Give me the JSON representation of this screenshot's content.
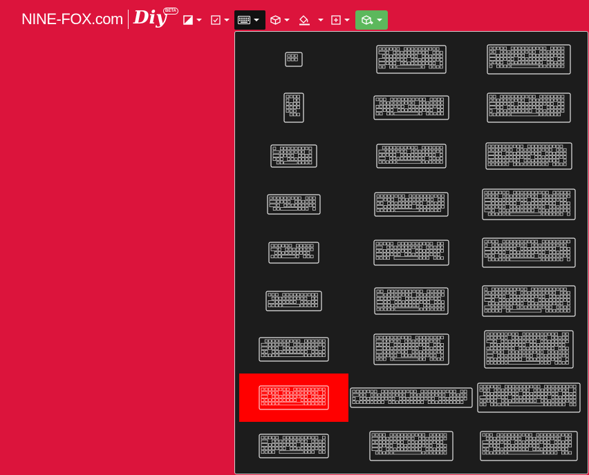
{
  "brand": {
    "logo_text": "NINE-FOX.com",
    "diy_text": "Diy",
    "beta_badge": "BETA"
  },
  "colors": {
    "background": "#dc143c",
    "menu_bg": "#1c1c1c",
    "active_tool": "#111111",
    "green_tool": "#5cb85c",
    "selected_item": "#ff0000"
  },
  "toolbar": [
    {
      "name": "color-tool",
      "icon": "paint-icon"
    },
    {
      "name": "select-tool",
      "icon": "checkbox-icon"
    },
    {
      "name": "layout-tool",
      "icon": "keyboard-icon",
      "active": true
    },
    {
      "name": "case-tool",
      "icon": "cube-icon"
    },
    {
      "name": "fill-tool",
      "icon": "paint-bucket-icon"
    },
    {
      "name": "add-tool",
      "icon": "plus-square-icon"
    },
    {
      "name": "export-tool",
      "icon": "box-share-icon",
      "highlight": true
    }
  ],
  "layout_menu": {
    "selected_index": 21,
    "items": [
      {
        "id": "keypad-4"
      },
      {
        "id": "60-percent"
      },
      {
        "id": "100-percent-a"
      },
      {
        "id": "numpad-vertical"
      },
      {
        "id": "60-percent-b"
      },
      {
        "id": "full-size-b"
      },
      {
        "id": "40-percent"
      },
      {
        "id": "60-percent-c"
      },
      {
        "id": "full-size-c"
      },
      {
        "id": "40-percent-b"
      },
      {
        "id": "65-percent"
      },
      {
        "id": "full-size-d"
      },
      {
        "id": "40-percent-c"
      },
      {
        "id": "65-percent-b"
      },
      {
        "id": "full-size-e"
      },
      {
        "id": "ortho-40"
      },
      {
        "id": "75-percent"
      },
      {
        "id": "full-size-f"
      },
      {
        "id": "50-percent"
      },
      {
        "id": "75-percent-b"
      },
      {
        "id": "1800-compact"
      },
      {
        "id": "60-percent-d"
      },
      {
        "id": "alice-split"
      },
      {
        "id": "full-size-g"
      },
      {
        "id": "60-percent-e"
      },
      {
        "id": "tkl"
      },
      {
        "id": "full-size-h"
      }
    ]
  }
}
